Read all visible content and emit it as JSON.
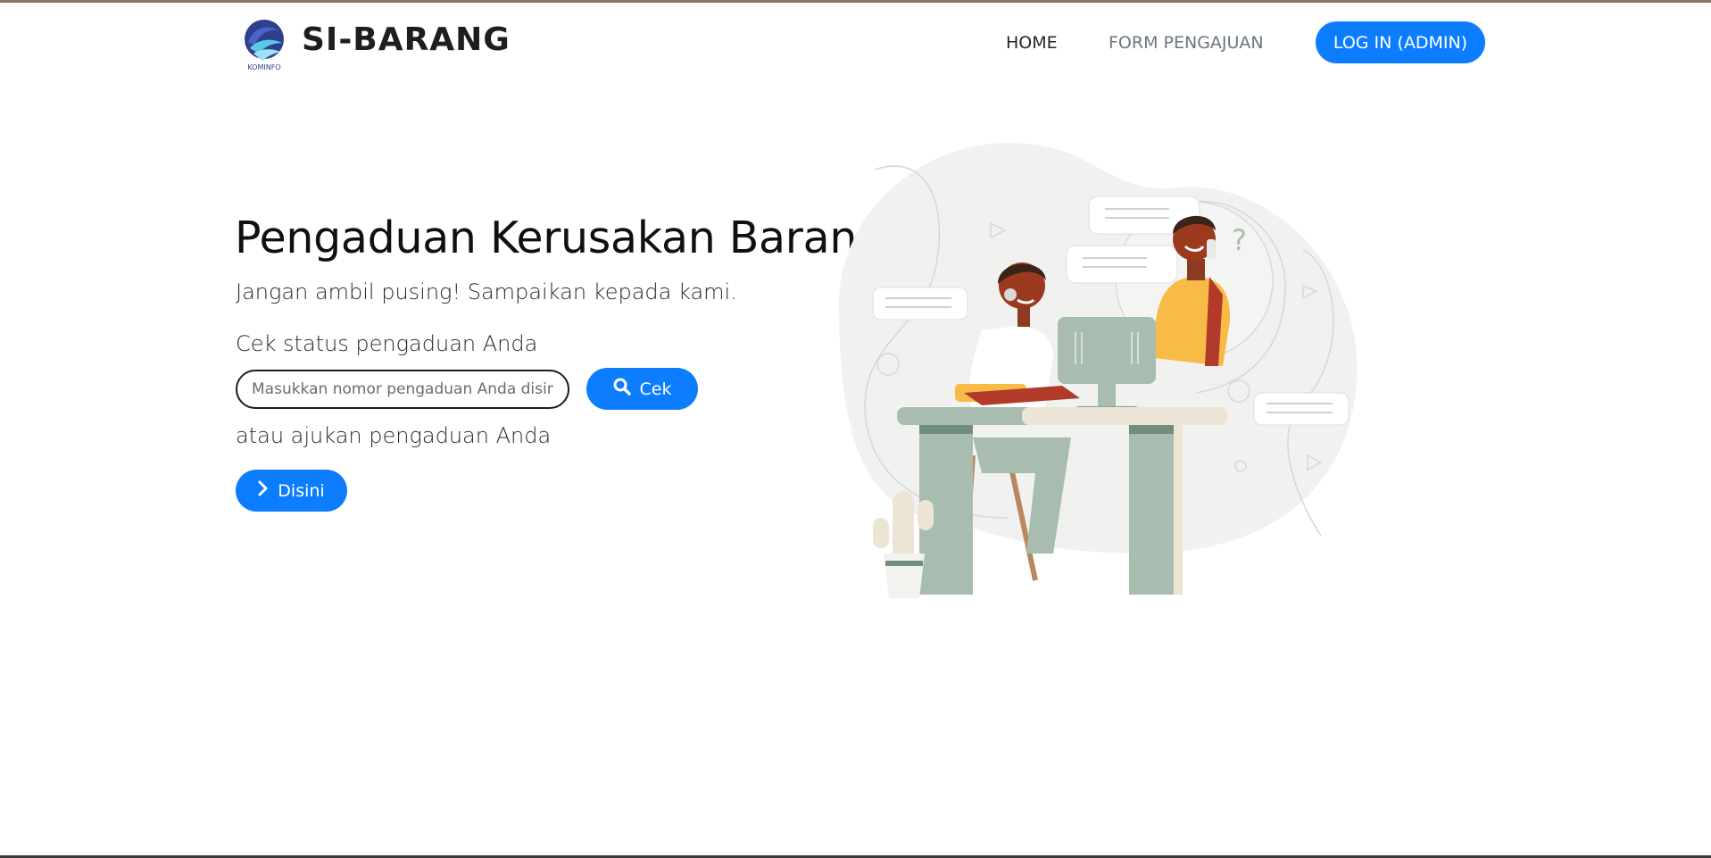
{
  "brand": {
    "name": "SI-BARANG",
    "logo_caption": "KOMINFO"
  },
  "nav": {
    "home": "HOME",
    "form": "FORM PENGAJUAN",
    "login": "LOG IN (ADMIN)"
  },
  "hero": {
    "title": "Pengaduan Kerusakan Barang?",
    "subtitle": "Jangan ambil pusing! Sampaikan kepada kami.",
    "check_label": "Cek status pengaduan Anda",
    "search_placeholder": "Masukkan nomor pengaduan Anda disini",
    "search_value": "",
    "check_button": "Cek",
    "or_label": "atau ajukan pengaduan Anda",
    "submit_button": "Disini"
  },
  "icons": {
    "search": "search-icon",
    "chevron": "chevron-right-icon"
  },
  "colors": {
    "accent": "#0d7dff",
    "text": "#212529",
    "muted_nav": "#6c757d"
  }
}
